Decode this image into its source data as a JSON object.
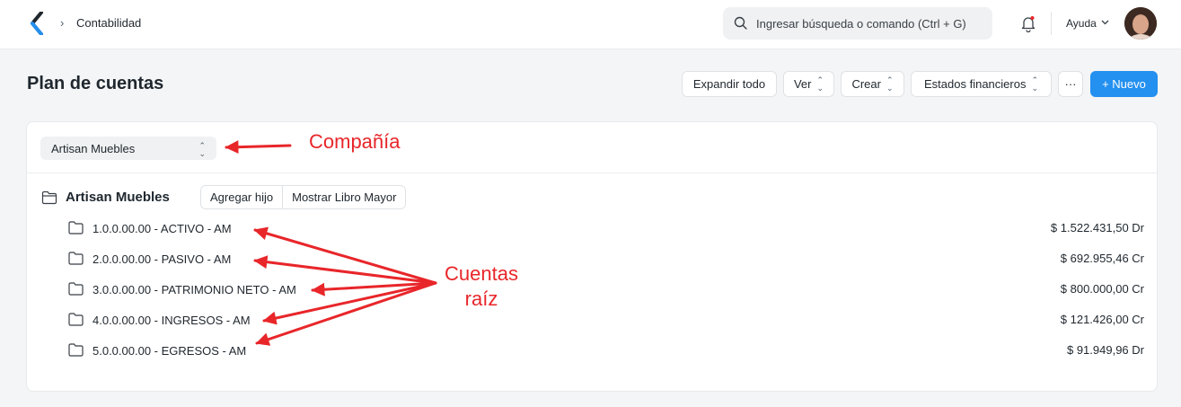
{
  "navbar": {
    "breadcrumb": "Contabilidad",
    "search_placeholder": "Ingresar búsqueda o comando (Ctrl + G)",
    "help_label": "Ayuda"
  },
  "page": {
    "title": "Plan de cuentas",
    "actions": {
      "expand_all": "Expandir todo",
      "view": "Ver",
      "create": "Crear",
      "financial_statements": "Estados financieros",
      "more": "···",
      "new": "+ Nuevo"
    }
  },
  "company_filter": {
    "value": "Artisan Muebles"
  },
  "tree": {
    "root": "Artisan Muebles",
    "root_actions": {
      "add_child": "Agregar hijo",
      "show_ledger": "Mostrar Libro Mayor"
    },
    "accounts": [
      {
        "name": "1.0.0.00.00 - ACTIVO - AM",
        "balance": "$ 1.522.431,50 Dr"
      },
      {
        "name": "2.0.0.00.00 - PASIVO - AM",
        "balance": "$ 692.955,46 Cr"
      },
      {
        "name": "3.0.0.00.00 - PATRIMONIO NETO - AM",
        "balance": "$ 800.000,00 Cr"
      },
      {
        "name": "4.0.0.00.00 - INGRESOS - AM",
        "balance": "$ 121.426,00 Cr"
      },
      {
        "name": "5.0.0.00.00 - EGRESOS - AM",
        "balance": "$ 91.949,96 Dr"
      }
    ]
  },
  "annotations": {
    "company_label": "Compañía",
    "root_accounts_line1": "Cuentas",
    "root_accounts_line2": "raíz",
    "color": "#e8262a"
  },
  "colors": {
    "primary": "#2490ef",
    "background": "#f4f5f6"
  }
}
